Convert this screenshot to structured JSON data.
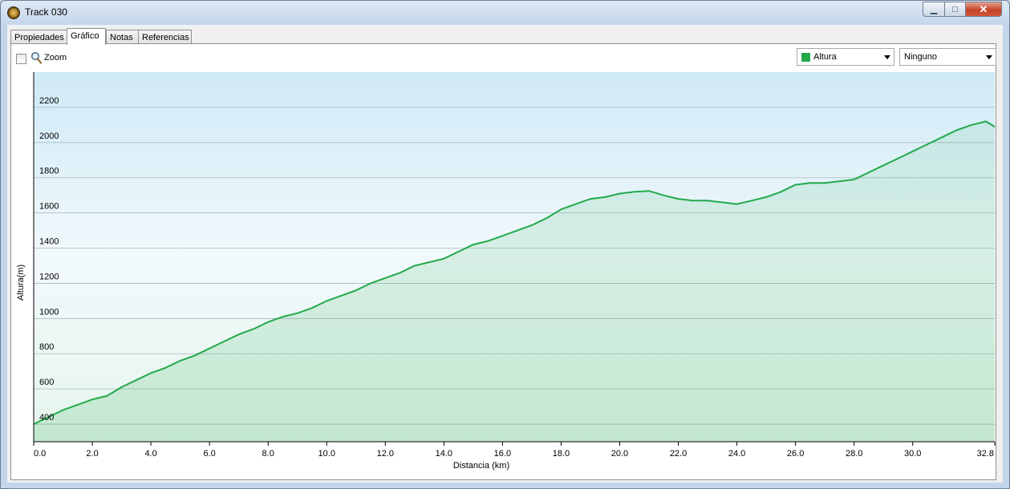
{
  "window": {
    "title": "Track 030",
    "minimize_glyph": "▁",
    "maximize_glyph": "□",
    "close_glyph": "✕",
    "icon": "gps-globe-icon"
  },
  "tabs": [
    {
      "label": "Propiedades",
      "active": false
    },
    {
      "label": "Gráfico",
      "active": true
    },
    {
      "label": "Notas",
      "active": false
    },
    {
      "label": "Referencias",
      "active": false
    }
  ],
  "toolbar": {
    "zoom_label": "Zoom",
    "zoom_checked": false,
    "series_select": "Altura",
    "series_color": "#22a94a",
    "secondary_select": "Ninguno"
  },
  "colors": {
    "line": "#22a94a",
    "grid": "#a8b8c0",
    "plot_top": "#cfeaf6",
    "plot_bottom": "#e6f6ec"
  },
  "chart_data": {
    "type": "area",
    "xlabel": "Distancia  (km)",
    "ylabel": "Altura(m)",
    "xlim": [
      0,
      32.8
    ],
    "ylim": [
      300,
      2400
    ],
    "x_ticks": [
      "0.0",
      "2.0",
      "4.0",
      "6.0",
      "8.0",
      "10.0",
      "12.0",
      "14.0",
      "16.0",
      "18.0",
      "20.0",
      "22.0",
      "24.0",
      "26.0",
      "28.0",
      "30.0",
      "32.8"
    ],
    "x_tick_values": [
      0,
      2,
      4,
      6,
      8,
      10,
      12,
      14,
      16,
      18,
      20,
      22,
      24,
      26,
      28,
      30,
      32.8
    ],
    "y_ticks": [
      "400",
      "600",
      "800",
      "1000",
      "1200",
      "1400",
      "1600",
      "1800",
      "2000",
      "2200"
    ],
    "y_tick_values": [
      400,
      600,
      800,
      1000,
      1200,
      1400,
      1600,
      1800,
      2000,
      2200
    ],
    "grid": true,
    "series": [
      {
        "x": [
          0,
          0.5,
          1,
          1.5,
          2,
          2.5,
          3,
          3.5,
          4,
          4.5,
          5,
          5.5,
          6,
          6.5,
          7,
          7.5,
          8,
          8.5,
          9,
          9.5,
          10,
          10.5,
          11,
          11.5,
          12,
          12.5,
          13,
          13.5,
          14,
          14.5,
          15,
          15.5,
          16,
          16.5,
          17,
          17.5,
          18,
          18.5,
          19,
          19.5,
          20,
          20.5,
          21,
          21.5,
          22,
          22.5,
          23,
          23.5,
          24,
          24.5,
          25,
          25.5,
          26,
          26.5,
          27,
          27.5,
          28,
          28.5,
          29,
          29.5,
          30,
          30.5,
          31,
          31.5,
          32,
          32.5,
          32.8
        ],
        "y": [
          400,
          440,
          480,
          510,
          540,
          560,
          610,
          650,
          690,
          720,
          760,
          790,
          830,
          870,
          910,
          940,
          980,
          1010,
          1030,
          1060,
          1100,
          1130,
          1160,
          1200,
          1230,
          1260,
          1300,
          1320,
          1340,
          1380,
          1420,
          1440,
          1470,
          1500,
          1530,
          1570,
          1620,
          1650,
          1680,
          1690,
          1710,
          1720,
          1725,
          1700,
          1680,
          1670,
          1670,
          1660,
          1650,
          1670,
          1690,
          1720,
          1760,
          1770,
          1770,
          1780,
          1790,
          1830,
          1870,
          1910,
          1950,
          1990,
          2030,
          2070,
          2100,
          2120,
          2090
        ]
      }
    ]
  }
}
